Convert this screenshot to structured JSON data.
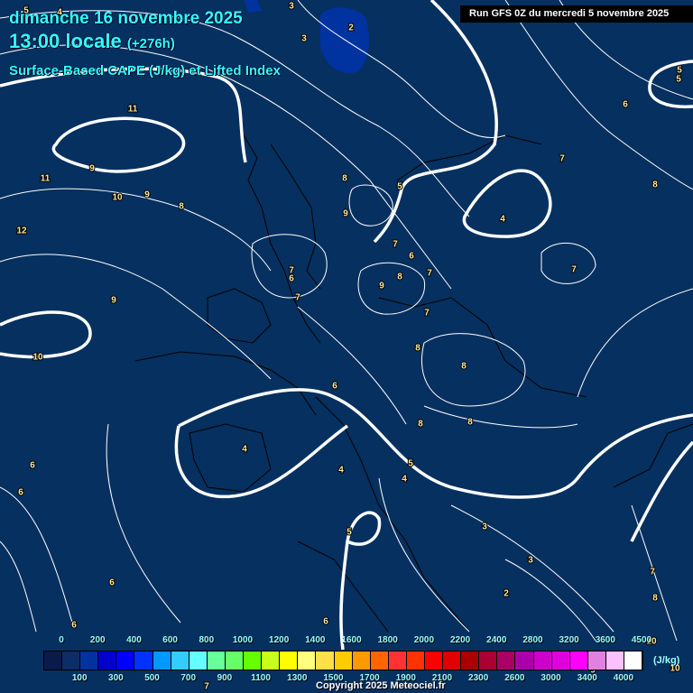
{
  "header": {
    "date": "dimanche 16 novembre 2025",
    "time": "13:00 locale",
    "lead": "(+276h)",
    "parameter": "Surface-Based CAPE (J/kg) et Lifted Index",
    "run": "Run GFS 0Z du mercredi 5 novembre 2025"
  },
  "legend": {
    "top_labels": [
      "0",
      "200",
      "400",
      "600",
      "800",
      "1000",
      "1200",
      "1400",
      "1600",
      "1800",
      "2000",
      "2200",
      "2400",
      "2800",
      "3200",
      "3600",
      "4500"
    ],
    "bottom_labels": [
      "100",
      "300",
      "500",
      "700",
      "900",
      "1100",
      "1300",
      "1500",
      "1700",
      "1900",
      "2100",
      "2300",
      "2600",
      "3000",
      "3400",
      "4000"
    ],
    "unit": "(J/kg)",
    "colors": [
      "#0a1a4a",
      "#0b2e66",
      "#0033a0",
      "#0000cc",
      "#0000ff",
      "#0033ff",
      "#0099ff",
      "#33ccff",
      "#66ffff",
      "#66ff99",
      "#66ff66",
      "#66ff00",
      "#c8ff1e",
      "#ffff00",
      "#ffff80",
      "#ffe04b",
      "#ffcc00",
      "#ff9900",
      "#ff6600",
      "#ff3333",
      "#ff3300",
      "#ff0000",
      "#e00000",
      "#aa0000",
      "#aa0033",
      "#aa0066",
      "#aa00aa",
      "#cc00cc",
      "#dd00dd",
      "#ff00ff",
      "#e080e0",
      "#ffc0ff",
      "#ffffff"
    ]
  },
  "lifted_index_labels": [
    "5",
    "4",
    "3",
    "3",
    "2",
    "11",
    "9",
    "11",
    "10",
    "9",
    "8",
    "12",
    "9",
    "10",
    "8",
    "9",
    "7",
    "6",
    "7",
    "5",
    "7",
    "6",
    "7",
    "9",
    "8",
    "7",
    "8",
    "8",
    "6",
    "8",
    "8",
    "4",
    "4",
    "5",
    "4",
    "5",
    "3",
    "3",
    "2",
    "6",
    "6",
    "6",
    "6",
    "6",
    "7",
    "8",
    "7",
    "4",
    "5",
    "5",
    "6",
    "7",
    "10",
    "10",
    "8",
    "9",
    "7"
  ],
  "copyright": "Copyright 2025 Meteociel.fr",
  "colors": {
    "background": "#06305f",
    "title": "#33ffff",
    "contour": "#ffffff"
  }
}
